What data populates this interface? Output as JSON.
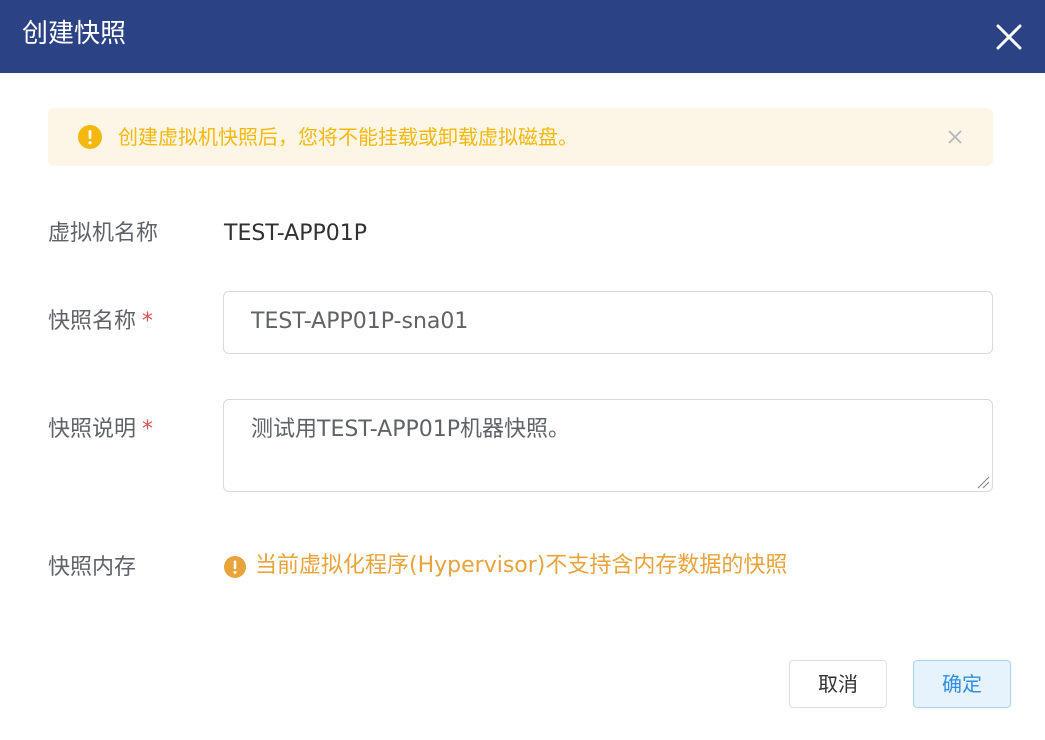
{
  "dialog": {
    "title": "创建快照"
  },
  "alert": {
    "message": "创建虚拟机快照后，您将不能挂载或卸载虚拟磁盘。",
    "color": "#f5b80f",
    "icon": "warning-circle-icon"
  },
  "form": {
    "vm_name_label": "虚拟机名称",
    "vm_name_value": "TEST-APP01P",
    "snapshot_name_label": "快照名称",
    "snapshot_name_value": "TEST-APP01P-sna01",
    "snapshot_desc_label": "快照说明",
    "snapshot_desc_value": "测试用TEST-APP01P机器快照。",
    "required_mark": "*",
    "memory_label": "快照内存",
    "memory_warning": "当前虚拟化程序(Hypervisor)不支持含内存数据的快照"
  },
  "footer": {
    "cancel_label": "取消",
    "ok_label": "确定"
  },
  "colors": {
    "header_bg": "#2b4284",
    "alert_bg": "#fdf6e6",
    "warning": "#e8a33a",
    "primary": "#2f8ee0",
    "required": "#e0504f"
  }
}
